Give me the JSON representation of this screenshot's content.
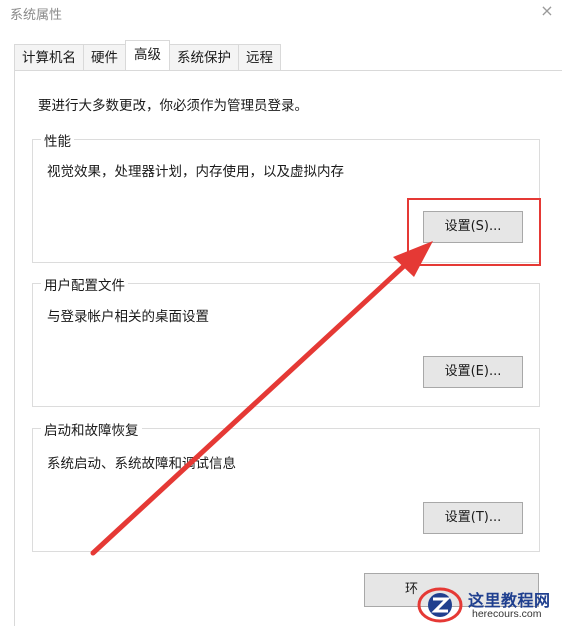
{
  "window": {
    "title": "系统属性",
    "close_icon": "×"
  },
  "tabs": [
    {
      "label": "计算机名"
    },
    {
      "label": "硬件"
    },
    {
      "label": "高级"
    },
    {
      "label": "系统保护"
    },
    {
      "label": "远程"
    }
  ],
  "notice": "要进行大多数更改，你必须作为管理员登录。",
  "groups": {
    "performance": {
      "label": "性能",
      "description": "视觉效果，处理器计划，内存使用，以及虚拟内存",
      "button": "设置(S)..."
    },
    "user_profiles": {
      "label": "用户配置文件",
      "description": "与登录帐户相关的桌面设置",
      "button": "设置(E)..."
    },
    "startup": {
      "label": "启动和故障恢复",
      "description": "系统启动、系统故障和调试信息",
      "button": "设置(T)..."
    }
  },
  "bottom_button_visible_text": "环",
  "annotation": {
    "color": "#e53935"
  },
  "watermark": {
    "name": "这里教程网",
    "url": "herecours.com"
  }
}
